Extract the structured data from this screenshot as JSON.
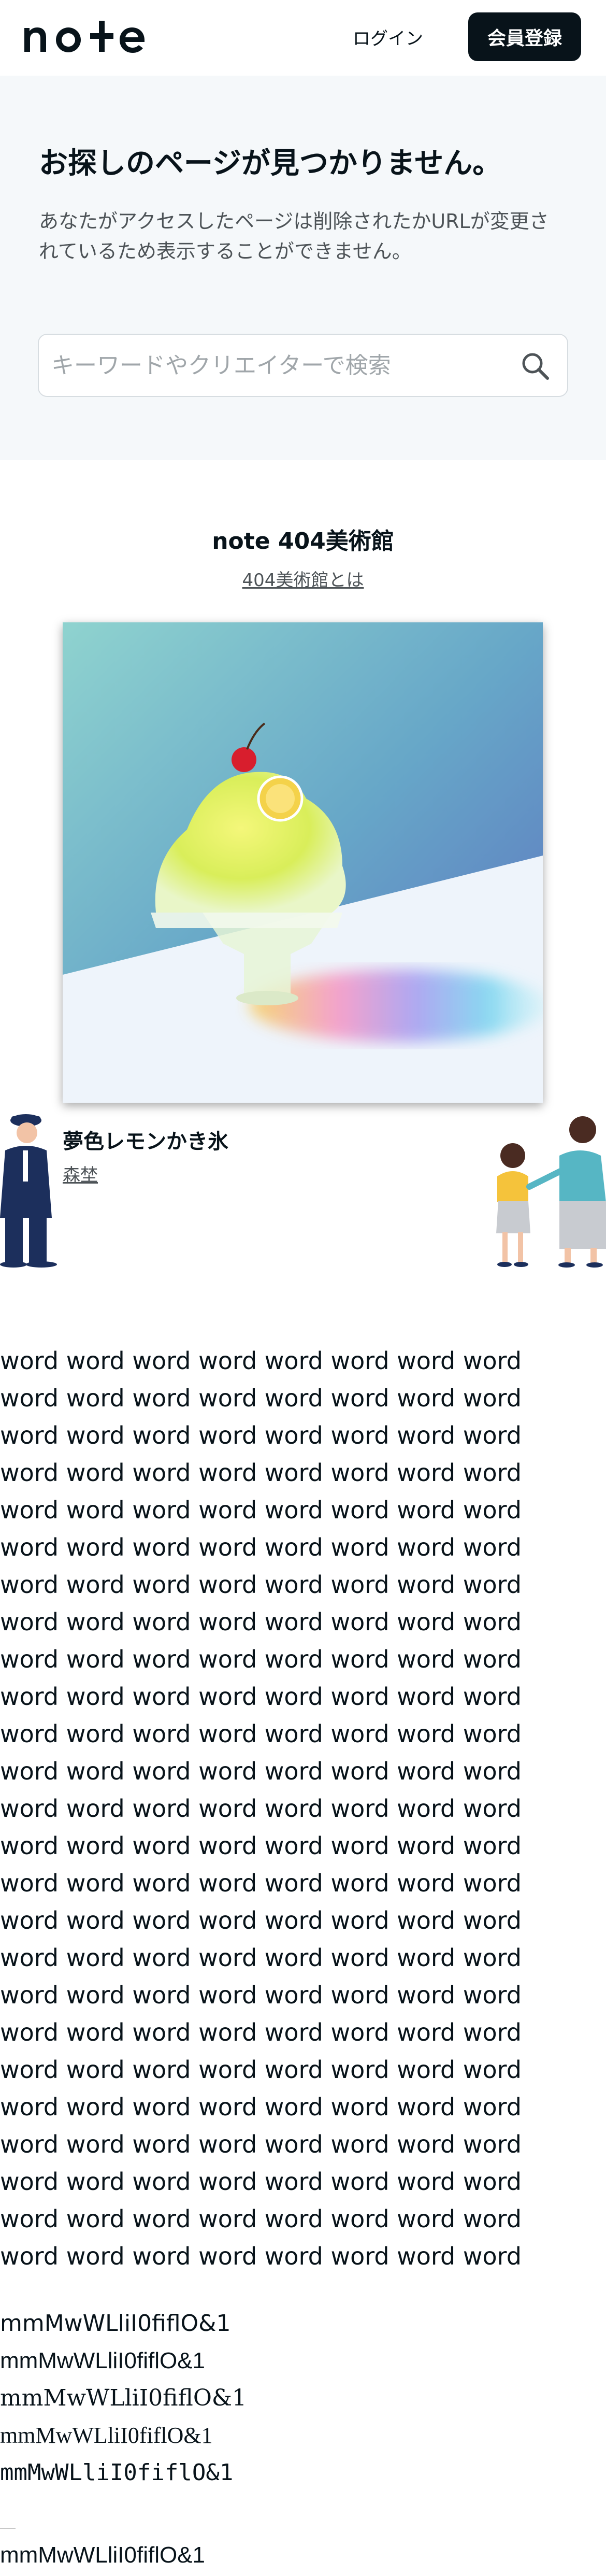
{
  "header": {
    "logo": "note",
    "login_label": "ログイン",
    "signup_label": "会員登録"
  },
  "not_found": {
    "title": "お探しのページが見つかりません。",
    "description": "あなたがアクセスしたページは削除されたかURLが変更されているため表示することができません。",
    "search_placeholder": "キーワードやクリエイターで検索"
  },
  "museum": {
    "title": "note 404美術館",
    "about_link": "404美術館とは",
    "artwork_title": "夢色レモンかき氷",
    "artwork_author": "森埜"
  },
  "words": {
    "line": "word word word word word word word word",
    "line_count": 25
  },
  "font_samples": [
    "mmMwWLliI0fiflO&1",
    "mmMwWLliI0fiflO&1",
    "mmMwWLliI0fiflO&1",
    "mmMwWLliI0fiflO&1",
    "mmMwWLliI0fiflO&1"
  ],
  "font_sample_last": "mmMwWLliI0fiflO&1",
  "colors": {
    "brand_dark": "#08131a",
    "section_bg": "#f5f8fa"
  },
  "icons": {
    "search": "search-icon"
  }
}
